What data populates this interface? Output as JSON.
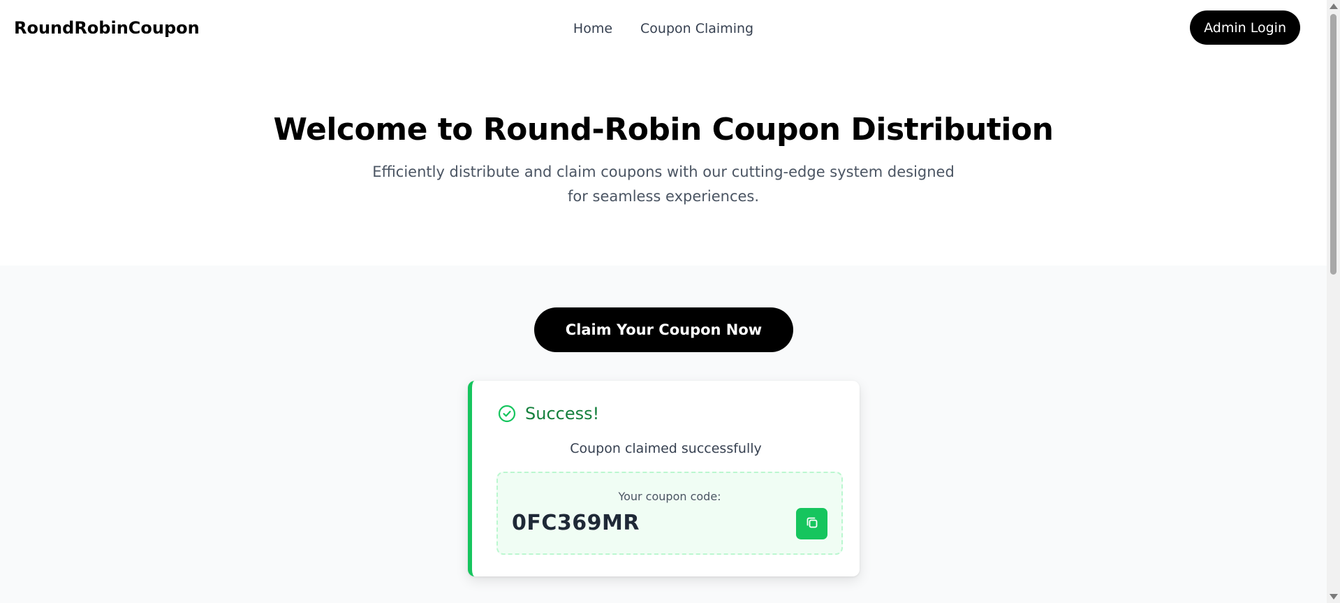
{
  "header": {
    "brand": "RoundRobinCoupon",
    "nav": [
      {
        "label": "Home"
      },
      {
        "label": "Coupon Claiming"
      }
    ],
    "admin_login_label": "Admin Login"
  },
  "hero": {
    "title": "Welcome to Round-Robin Coupon Distribution",
    "subtitle": "Efficiently distribute and claim coupons with our cutting-edge system designed for seamless experiences."
  },
  "claim": {
    "button_label": "Claim Your Coupon Now"
  },
  "result": {
    "title": "Success!",
    "message": "Coupon claimed successfully",
    "code_label": "Your coupon code:",
    "code": "0FC369MR"
  },
  "icons": {
    "success": "check-circle-icon",
    "copy": "copy-icon"
  },
  "colors": {
    "success": "#16c55e",
    "success_text": "#15803d",
    "primary": "#000000",
    "code_box_bg": "#f0fdf4"
  }
}
